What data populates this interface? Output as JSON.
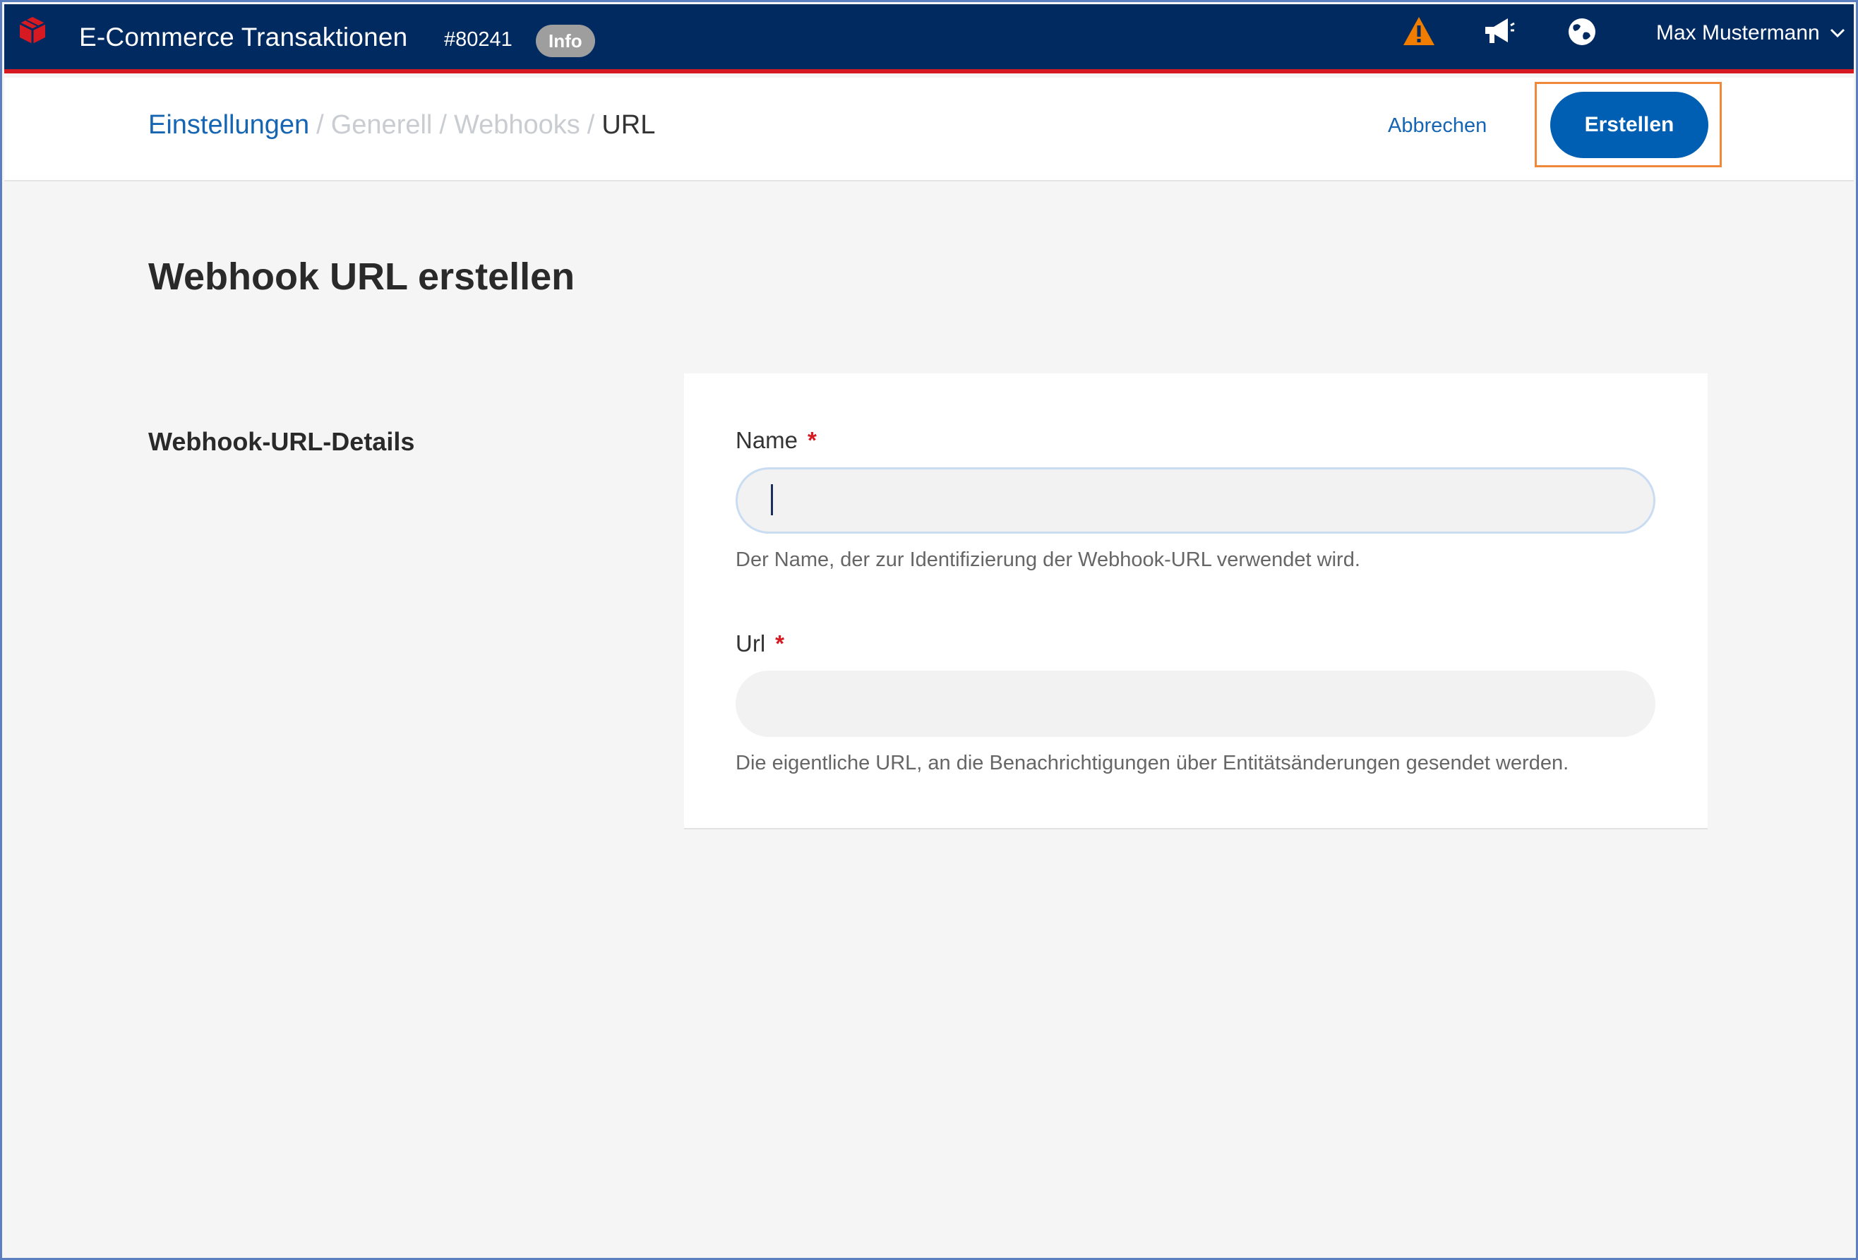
{
  "topbar": {
    "app_title": "E-Commerce Transaktionen",
    "space_id": "#80241",
    "badge": "Info",
    "icons": [
      "warning-icon",
      "megaphone-icon",
      "globe-icon"
    ],
    "user_name": "Max Mustermann",
    "colors": {
      "background": "#002a60",
      "accent_line": "#d71a21",
      "warning": "#f07c00"
    }
  },
  "breadcrumb": {
    "items": [
      "Einstellungen",
      "Generell",
      "Webhooks",
      "URL"
    ],
    "separator": "/"
  },
  "actions": {
    "cancel_label": "Abbrechen",
    "create_label": "Erstellen",
    "primary_color": "#005fb2"
  },
  "page": {
    "title": "Webhook URL erstellen",
    "section_label": "Webhook-URL-Details"
  },
  "form": {
    "name": {
      "label": "Name",
      "required_mark": "*",
      "value": "",
      "help": "Der Name, der zur Identifizierung der Webhook-URL verwendet wird."
    },
    "url": {
      "label": "Url",
      "required_mark": "*",
      "value": "",
      "help": "Die eigentliche URL, an die Benachrichtigungen über Entitätsänderungen gesendet werden."
    }
  }
}
